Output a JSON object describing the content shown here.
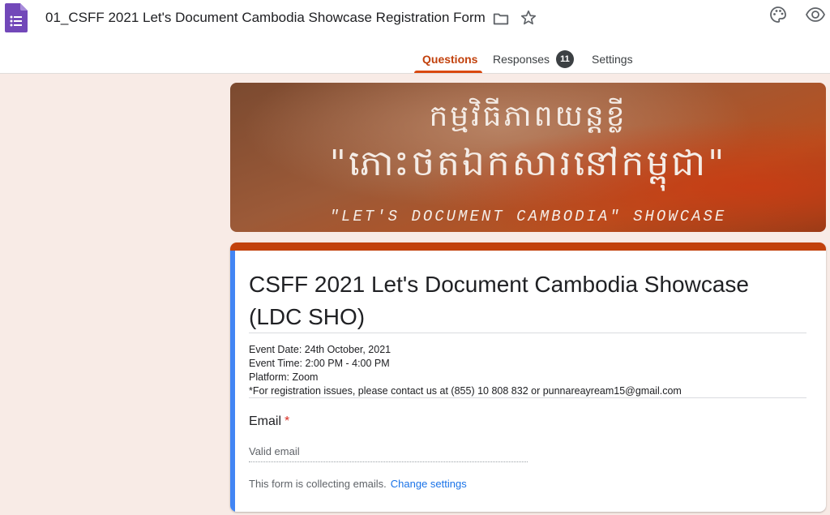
{
  "header": {
    "title": "01_CSFF 2021 Let's Document Cambodia Showcase Registration Form",
    "icons": [
      "forms-app-icon",
      "folder-icon",
      "star-icon",
      "palette-icon",
      "preview-eye-icon"
    ]
  },
  "tabs": {
    "questions": "Questions",
    "responses": "Responses",
    "responses_count": "11",
    "settings": "Settings"
  },
  "banner": {
    "line1": "កម្មវិធីភាពយន្តខ្លី",
    "line2": "\"ភោះថតឯកសារនៅកម្ពុជា\"",
    "line3": "\"LET'S DOCUMENT CAMBODIA\" SHOWCASE"
  },
  "form": {
    "title": "CSFF 2021 Let's Document Cambodia Showcase (LDC SHO)",
    "description": [
      "Event Date: 24th October, 2021",
      "Event Time: 2:00 PM - 4:00 PM",
      "Platform: Zoom",
      "*For registration issues, please contact us at (855) 10 808 832 or punnareayream15@gmail.com"
    ],
    "email_label": "Email",
    "required_mark": "*",
    "email_placeholder": "Valid email",
    "collect_note": "This form is collecting emails.",
    "change_settings": "Change settings"
  },
  "colors": {
    "accent": "#c2410c",
    "left_bar": "#4285f4",
    "background": "#f8ebe6",
    "link": "#1a73e8",
    "required": "#d93025"
  }
}
